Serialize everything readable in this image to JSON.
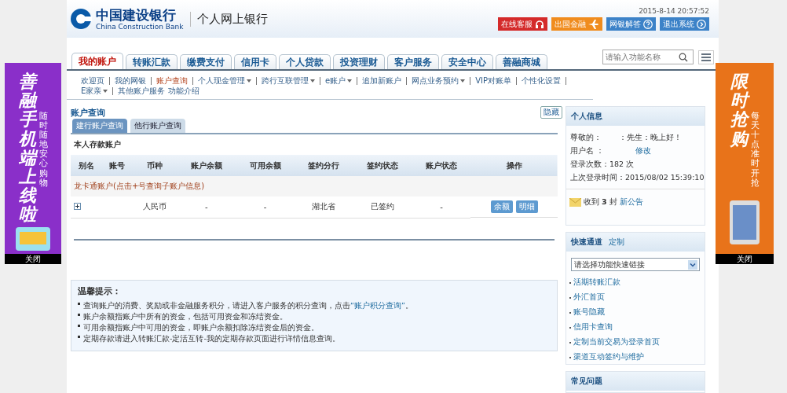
{
  "header": {
    "bank_name": "中国建设银行",
    "bank_name_en": "China Construction Bank",
    "product": "个人网上银行",
    "datetime": "2015-8-14 20:57:52",
    "buttons": [
      {
        "label": "在线客服",
        "color": "#d42a2a",
        "kind": "headset"
      },
      {
        "label": "出国金融",
        "color": "#f08c1e",
        "kind": "plane"
      },
      {
        "label": "网银解答",
        "color": "#3c82c8",
        "kind": "help"
      },
      {
        "label": "退出系统",
        "color": "#3c82c8",
        "kind": "next"
      }
    ]
  },
  "tabs": [
    {
      "label": "我的账户",
      "selected": true
    },
    {
      "label": "转账汇款",
      "selected": false
    },
    {
      "label": "缴费支付",
      "selected": false
    },
    {
      "label": "信用卡",
      "selected": false
    },
    {
      "label": "个人贷款",
      "selected": false
    },
    {
      "label": "投资理财",
      "selected": false
    },
    {
      "label": "客户服务",
      "selected": false
    },
    {
      "label": "安全中心",
      "selected": false
    },
    {
      "label": "善融商城",
      "selected": false
    }
  ],
  "search": {
    "placeholder": "请输入功能名称"
  },
  "subnav": [
    {
      "label": "欢迎页",
      "selected": false,
      "dropdown": false
    },
    {
      "label": "我的网银",
      "selected": false,
      "dropdown": false
    },
    {
      "label": "账户查询",
      "selected": true,
      "dropdown": false
    },
    {
      "label": "个人现金管理",
      "selected": false,
      "dropdown": true
    },
    {
      "label": "跨行互联管理",
      "selected": false,
      "dropdown": true
    },
    {
      "label": "e账户",
      "selected": false,
      "dropdown": true
    },
    {
      "label": "追加新账户",
      "selected": false,
      "dropdown": false
    },
    {
      "label": "网点业务预约",
      "selected": false,
      "dropdown": true
    },
    {
      "label": "VIP对账单",
      "selected": false,
      "dropdown": false
    },
    {
      "label": "个性化设置",
      "selected": false,
      "dropdown": false
    },
    {
      "label": "E家亲",
      "selected": false,
      "dropdown": true
    },
    {
      "label": "其他账户服务",
      "selected": false,
      "dropdown": false
    },
    {
      "label": "功能介绍",
      "selected": false,
      "dropdown": false
    }
  ],
  "main": {
    "title": "账户查询",
    "hide_button": "隐藏",
    "subtabs": [
      {
        "label": "建行账户查询",
        "selected": true
      },
      {
        "label": "他行账户查询",
        "selected": false
      }
    ],
    "section_title": "本人存款账户",
    "table": {
      "columns": [
        "别名",
        "账号",
        "币种",
        "账户余额",
        "可用余额",
        "签约分行",
        "签约状态",
        "账户状态",
        "操作"
      ],
      "group_label": "龙卡通账户(点击+号查询子账户信息)",
      "rows": [
        {
          "cells": [
            "",
            "",
            "人民币",
            "-",
            "-",
            "湖北省",
            "已签约",
            "-"
          ],
          "actions": [
            "余额",
            "明细"
          ]
        }
      ]
    },
    "tips": {
      "title": "温馨提示：",
      "items": [
        {
          "text": "查询账户的消费、奖励或非金融服务积分，请进入客户服务的积分查询，点击",
          "link": "“账户积分查询”",
          "after": "。"
        },
        {
          "text": "账户余额指账户中所有的资金，包括可用资金和冻结资金。"
        },
        {
          "text": "可用余额指账户中可用的资金，即账户余额扣除冻结资金后的资金。"
        },
        {
          "text": "定期存款请进入转账汇款-定活互转-我的定期存款页面进行详情信息查询。"
        }
      ]
    }
  },
  "sidebar": {
    "info_title": "个人信息",
    "greeting_label": "尊敬的：",
    "greeting": "：先生：晚上好！",
    "username_label": "用户名 ：",
    "edit_link": "修改",
    "login_count": "登录次数：182 次",
    "last_login": "上次登录时间：2015/08/02 15:39:10",
    "notice_prefix": "收到",
    "notice_count": "3",
    "notice_mid": "封",
    "notice_link": "新公告",
    "quick_title": "快速通道",
    "quick_custom": "定制",
    "quick_select": "请选择功能快速链接",
    "quick_links": [
      "活期转账汇款",
      "外汇首页",
      "账号隐藏",
      "信用卡查询",
      "定制当前交易为登录首页",
      "渠道互动签约与维护"
    ],
    "faq_title": "常见问题"
  },
  "ads": [
    {
      "headline": "善融手机端上线啦",
      "tagline": "随时随地安心购物",
      "close": "关闭",
      "color": "#8a2fc9"
    },
    {
      "headline": "限时抢购",
      "tagline": "每天十点准时开抢",
      "close": "关闭",
      "color": "#e8731a"
    }
  ]
}
